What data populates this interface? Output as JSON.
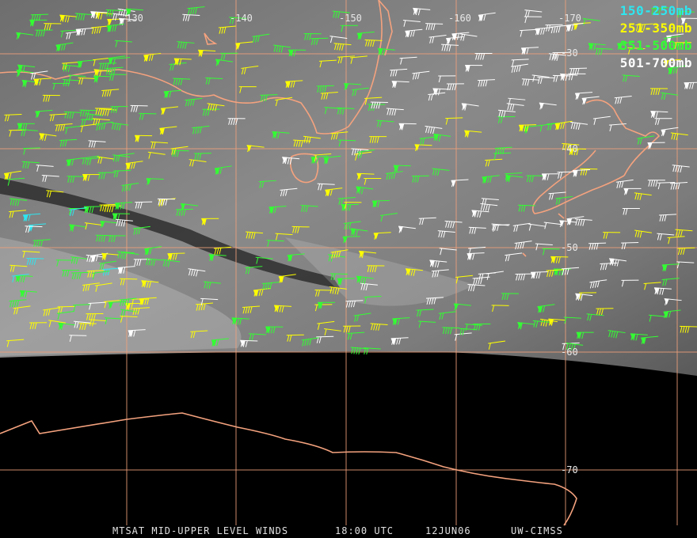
{
  "map": {
    "longitude_labels": [
      "-130",
      "-140",
      "-150",
      "-160",
      "-170"
    ],
    "latitude_labels": [
      "-30",
      "-40",
      "-50",
      "-60",
      "-70"
    ],
    "legend": [
      {
        "label": "150-250mb",
        "color": "#2ee6f0"
      },
      {
        "label": "251-350mb",
        "color": "#ffff00"
      },
      {
        "label": "351-500mb",
        "color": "#33ff33"
      },
      {
        "label": "501-700mb",
        "color": "#ffffff"
      }
    ],
    "grid_color": "#f0a07a",
    "coastline_color": "#f4a27e",
    "background_imagery": "water vapor grayscale",
    "no_data_color": "#000000"
  },
  "footer": {
    "product": "MTSAT MID-UPPER LEVEL WINDS",
    "time": "18:00 UTC",
    "date": "12JUN06",
    "source": "UW-CIMSS"
  }
}
